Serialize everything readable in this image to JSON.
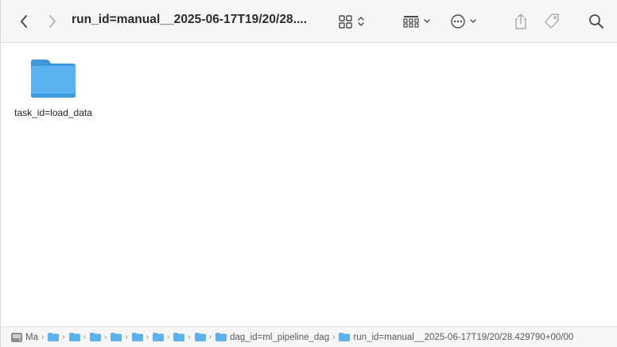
{
  "window": {
    "title": "run_id=manual__2025-06-17T19/20/28...."
  },
  "toolbar": {
    "back_icon": "chevron-left",
    "forward_icon": "chevron-right",
    "view_icon": "grid-view",
    "group_icon": "group-by",
    "action_icon": "ellipsis-circle",
    "share_icon": "share",
    "tag_icon": "tag",
    "search_icon": "magnifying-glass"
  },
  "content": {
    "items": [
      {
        "name": "task_id=load_data",
        "icon": "folder"
      }
    ]
  },
  "pathbar": {
    "segments": [
      {
        "label": "Ma",
        "icon": "disk"
      },
      {
        "label": "",
        "icon": "folder"
      },
      {
        "label": "",
        "icon": "folder"
      },
      {
        "label": "",
        "icon": "folder"
      },
      {
        "label": "",
        "icon": "folder"
      },
      {
        "label": "",
        "icon": "folder"
      },
      {
        "label": "",
        "icon": "folder"
      },
      {
        "label": "",
        "icon": "folder"
      },
      {
        "label": "",
        "icon": "folder"
      },
      {
        "label": "dag_id=ml_pipeline_dag",
        "icon": "folder"
      },
      {
        "label": "run_id=manual__2025-06-17T19/20/28.429790+00/00",
        "icon": "folder"
      }
    ]
  },
  "colors": {
    "folder": "#5ab3f0",
    "folder_tab": "#3d98dc",
    "toolbar_bg": "#f6f6f6"
  }
}
